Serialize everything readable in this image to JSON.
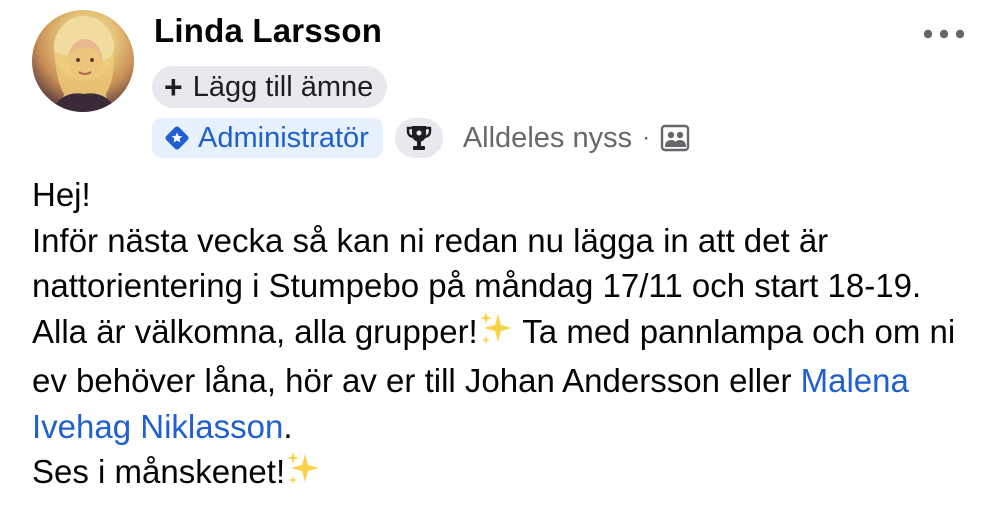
{
  "post": {
    "author": "Linda Larsson",
    "add_topic_label": "Lägg till ämne",
    "admin_badge": "Administratör",
    "timestamp": "Alldeles nyss",
    "separator": "·",
    "body": {
      "line1": "Hej!",
      "line2": "Inför nästa vecka så kan ni redan nu lägga in att det är nattorientering i Stumpebo på måndag 17/11 och start 18-19. Alla är välkomna, alla grupper!",
      "line2b": " Ta med pannlampa och om ni ev behöver låna, hör av er till Johan Andersson eller ",
      "mention": "Malena Ivehag Niklasson",
      "after_mention": ".",
      "line3": "Ses i månskenet!"
    },
    "icons": {
      "more": "more-horizontal-icon",
      "plus": "plus-icon",
      "admin": "admin-diamond-icon",
      "trophy": "trophy-icon",
      "audience": "group-audience-icon",
      "sparkles": "sparkles-emoji"
    },
    "colors": {
      "accent": "#1f5fd1",
      "admin_bg": "#e7f0fd",
      "chip_bg": "#e8e9ee",
      "muted": "#65676b"
    }
  }
}
